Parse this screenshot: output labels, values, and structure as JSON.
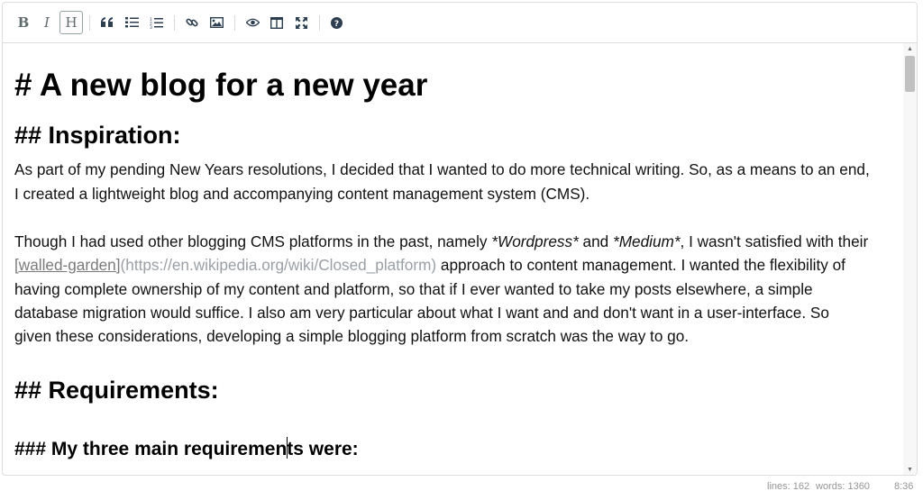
{
  "toolbar": {
    "bold": "B",
    "italic": "I",
    "heading": "H",
    "icons": [
      "quote-icon",
      "unordered-list-icon",
      "ordered-list-icon",
      "link-icon",
      "image-icon",
      "preview-icon",
      "side-by-side-icon",
      "fullscreen-icon",
      "help-icon"
    ]
  },
  "document": {
    "h1": "# A new blog for a new year",
    "h2_inspiration": "## Inspiration:",
    "p1_line1": "As part of my pending New Years resolutions, I decided that I wanted to do more technical writing.  So, as a means to an end,",
    "p1_line2": "I created a lightweight blog and accompanying content management system (CMS).",
    "p2_line1_a": "Though I had used other blogging CMS platforms in the past, namely ",
    "p2_line1_b": "*Wordpress*",
    "p2_line1_c": " and ",
    "p2_line1_d": "*Medium*",
    "p2_line1_e": ", I wasn't satisfied with their",
    "p2_line2_link": "[walled-garden]",
    "p2_line2_url": "(https://en.wikipedia.org/wiki/Closed_platform)",
    "p2_line2_rest": " approach to content management. I wanted the flexibility of",
    "p2_line3": "having complete ownership of my content and platform, so that if I ever wanted to take my posts elsewhere, a simple",
    "p2_line4": "database migration would suffice.  I also am very particular about what I want and and don't want in a user-interface.  So",
    "p2_line5": "given these considerations, developing a simple blogging platform from scratch was the way to go.",
    "h2_requirements": "## Requirements:",
    "h3_before_cursor": "### My three main requiremen",
    "h3_after_cursor": "ts were:"
  },
  "status": {
    "lines": "lines: 162",
    "words": "words: 1360",
    "cursor": "8:36"
  }
}
